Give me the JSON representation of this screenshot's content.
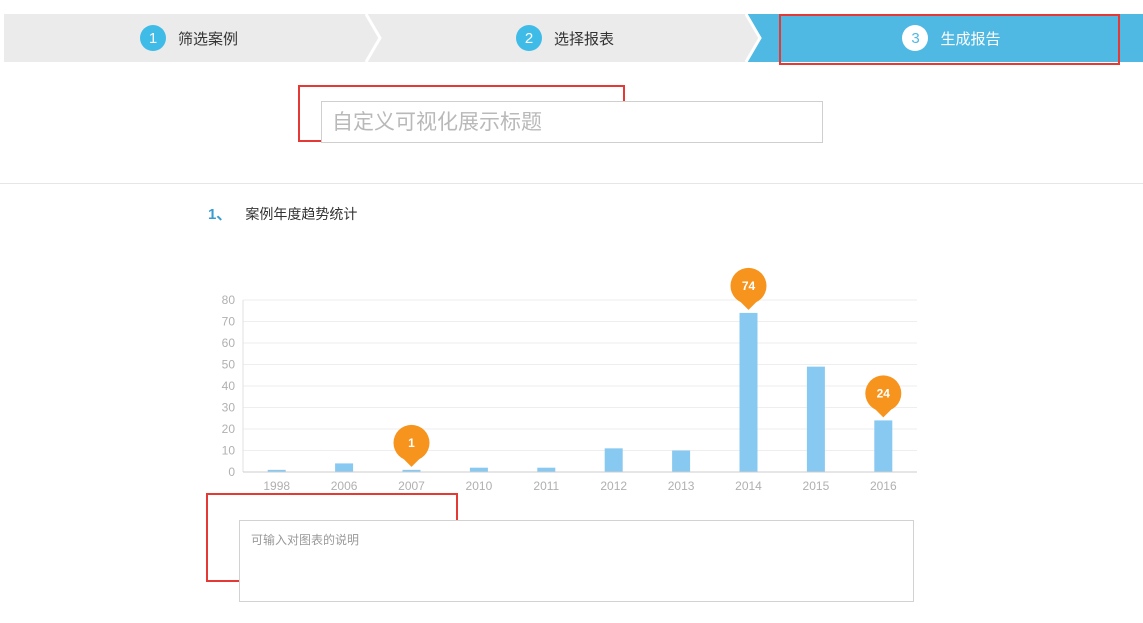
{
  "steps": [
    {
      "number": "1",
      "label": "筛选案例",
      "active": false
    },
    {
      "number": "2",
      "label": "选择报表",
      "active": false
    },
    {
      "number": "3",
      "label": "生成报告",
      "active": true
    }
  ],
  "colors": {
    "step_active": "#4fb9e3",
    "step_inactive": "#ebebeb",
    "bar": "#88c9f2",
    "pin": "#f7941d",
    "highlight_box": "#e53935"
  },
  "report": {
    "title_placeholder": "自定义可视化展示标题",
    "description_placeholder": "可输入对图表的说明"
  },
  "section": {
    "number": "1、",
    "title": "案例年度趋势统计"
  },
  "chart_data": {
    "type": "bar",
    "categories": [
      "1998",
      "2006",
      "2007",
      "2010",
      "2011",
      "2012",
      "2013",
      "2014",
      "2015",
      "2016"
    ],
    "values": [
      1,
      4,
      1,
      2,
      2,
      11,
      10,
      74,
      49,
      24
    ],
    "ylim": [
      0,
      80
    ],
    "yticks": [
      0,
      10,
      20,
      30,
      40,
      50,
      60,
      70,
      80
    ],
    "grid": true,
    "annotations": [
      {
        "category": "2007",
        "value": 1,
        "label": "1"
      },
      {
        "category": "2014",
        "value": 74,
        "label": "74"
      },
      {
        "category": "2016",
        "value": 24,
        "label": "24"
      }
    ]
  }
}
